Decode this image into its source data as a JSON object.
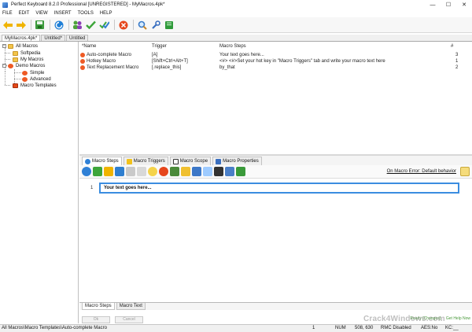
{
  "window": {
    "title": "Perfect Keyboard 8.2.0 Professional [UNREGISTERED] - MyMacros.4pk*",
    "controls": [
      "—",
      "☐",
      "✕"
    ]
  },
  "menu": [
    "FILE",
    "EDIT",
    "VIEW",
    "INSERT",
    "TOOLS",
    "HELP"
  ],
  "doc_tabs": [
    "MyMacros.4pk*",
    "Untitled*",
    "Untitled"
  ],
  "tree": {
    "items": [
      {
        "label": "All Macros"
      },
      {
        "label": "Softpedia"
      },
      {
        "label": "My Macros"
      },
      {
        "label": "Demo Macros"
      },
      {
        "label": "Simple"
      },
      {
        "label": "Advanced"
      },
      {
        "label": "Macro Templates"
      }
    ]
  },
  "list": {
    "headers": {
      "name": "*Name",
      "trigger": "Trigger",
      "steps": "Macro Steps",
      "num": "#"
    },
    "rows": [
      {
        "name": "Auto-complete Macro",
        "trigger": "[A]",
        "steps": "Your text goes here...",
        "num": "3"
      },
      {
        "name": "Hotkey Macro",
        "trigger": "[Shift+Ctrl+Alt+T]",
        "steps": "<#> <#>Set your hot key in \"Macro Triggers\" tab and write your macro text here",
        "num": "1"
      },
      {
        "name": "Text Replacement Macro",
        "trigger": "[.replace_this]",
        "steps": "by_that",
        "num": "2"
      }
    ]
  },
  "editor_tabs": [
    "Macro Steps",
    "Macro Triggers",
    "Macro Scope",
    "Macro Properties"
  ],
  "editor": {
    "on_error": "On Macro Error: Default behavior",
    "line_number": "1",
    "step_text": "Your text goes here..."
  },
  "bottom_tabs": [
    "Macro Steps",
    "Macro Text"
  ],
  "buttons": {
    "ok": "Ok",
    "cancel": "Cancel"
  },
  "status": {
    "path": "All Macros\\Macro Templates\\Auto-complete Macro",
    "count": "1",
    "num": "NUM",
    "coords": "508, 630",
    "rmc": "RMC Disabled",
    "aes": "AES:No",
    "kc": "KC:__"
  },
  "watermark": {
    "text1": "Ready [Changes]",
    "text2": "Get Help Now",
    "brand": "Crack4Windows.com"
  }
}
